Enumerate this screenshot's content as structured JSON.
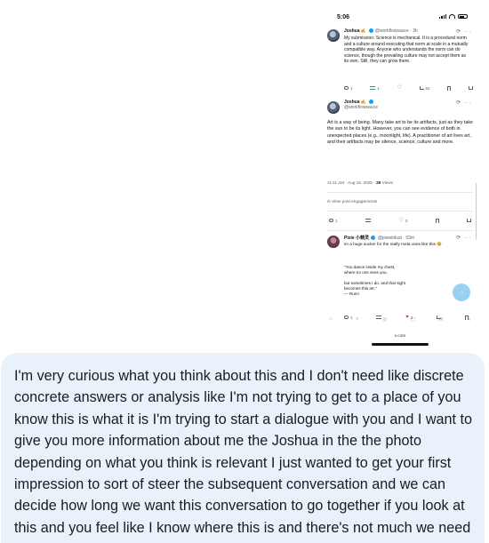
{
  "phone": {
    "status_time": "5:06",
    "tweet1": {
      "name": "Joshua",
      "handle_time": "@workflowsauce · 3h",
      "text": "My submission: Science is mechanical. It is a procedural norm and a culture around executing that norm at scale in a mutually compatible way. Anyone who understands the norm can do science, though the prevailing culture may not accept them as its own. Still, they can grow there.",
      "replies": "1",
      "reposts": "1",
      "likes": "",
      "views": "62"
    },
    "tweet2": {
      "name": "Joshua",
      "handle": "@workflowsauce",
      "text": "Art is a way of being. Many take art to be its artifacts, just as they take the sun to be its light. However, you can see evidence of both in unexpected places (e.g., moonlight, life). A practitioner of art lives art, and their artifacts may be silence, science, culture and more.",
      "time": "11:11 AM · Aug 15, 2025 · ",
      "views_count": "29",
      "views_label": " Views",
      "engagements": "View post engagements",
      "replies": "1",
      "likes": "3"
    },
    "tweet3": {
      "name": "Pixie 小精灵",
      "handle_time": "@pixieiidust · 53m",
      "text": "im a huge sucker for the really meta ones like this 🥹",
      "quote": "\"You dance inside my chest,\nwhere no one sees you,\n\nbut sometimes I do, and that sight\nbecomes this art.\"\n— Rumi",
      "replies": "1",
      "likes": "3"
    },
    "url": "x.com",
    "icons": {
      "reply": "reply-icon",
      "repost": "repost-icon",
      "like": "heart-icon",
      "views": "views-icon",
      "bookmark": "bookmark-icon",
      "share": "share-icon",
      "more": "more-icon",
      "grok": "grok-icon",
      "compose": "compose-icon"
    }
  },
  "message": {
    "text": "I'm very curious what you think about this and I don't need like discrete concrete answers or analysis like I'm not trying to get to a place of you know this is what it is I'm trying to start a dialogue with you and I want to give you more information about me the Joshua in the the photo depending on what you think is relevant I just wanted to get your first impression to sort of steer the subsequent conversation and we can decide how long we want this conversation to go together if you look at this and you feel like I know where this is and there's not much we need to say."
  },
  "colors": {
    "bubble_bg": "#e9f2fb",
    "x_blue": "#1d9bf0",
    "like_pink": "#f91880",
    "repost_green": "#2e9e5a"
  }
}
